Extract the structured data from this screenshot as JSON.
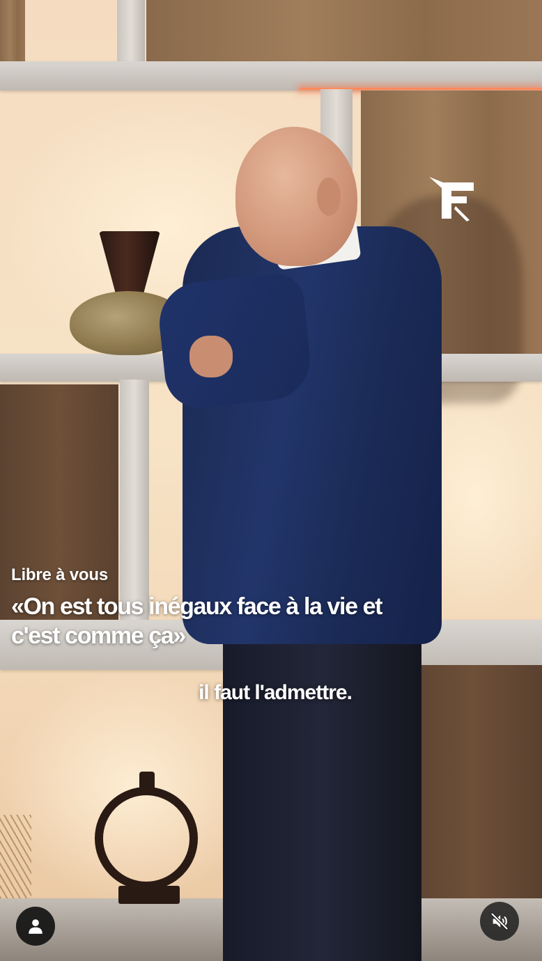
{
  "overlay": {
    "show_label": "Libre à vous",
    "headline": "«On est tous inégaux face à la vie et c'est comme ça»",
    "subtitle": "il faut l'admettre."
  },
  "logo": {
    "letter": "F"
  },
  "controls": {
    "avatar_icon": "user-icon",
    "mute_icon": "muted-speaker-icon"
  },
  "colors": {
    "overlay_text": "#ffffff",
    "button_bg": "#121212",
    "led_accent": "#ff8a5c"
  }
}
